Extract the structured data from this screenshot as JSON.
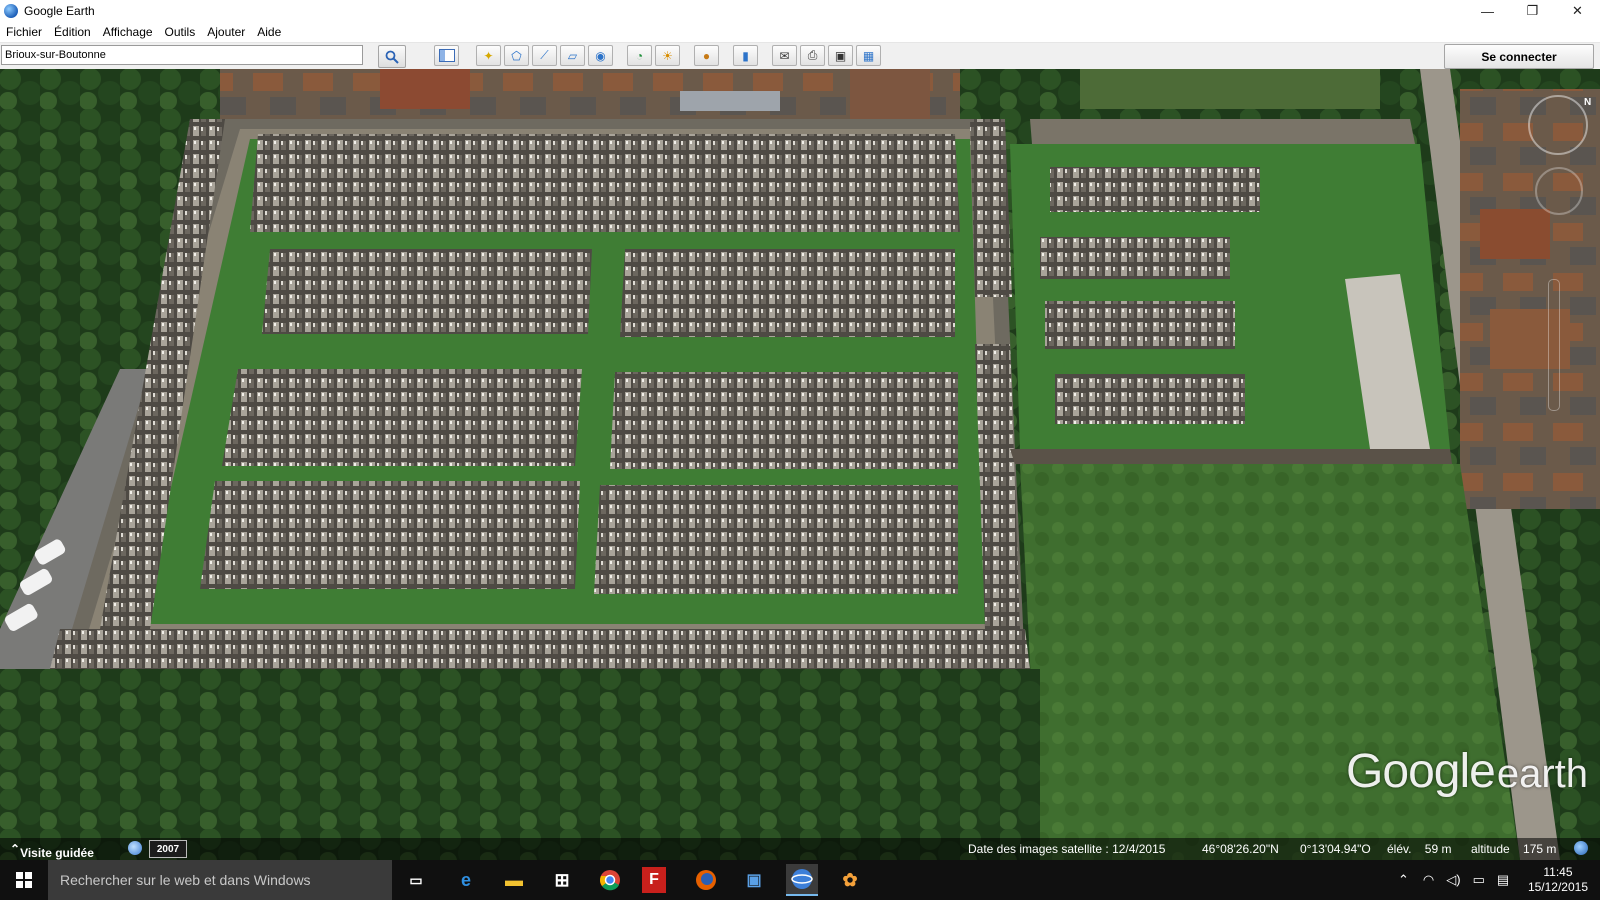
{
  "window": {
    "title": "Google Earth",
    "controls": [
      "—",
      "❐",
      "✕"
    ]
  },
  "menu": [
    "Fichier",
    "Édition",
    "Affichage",
    "Outils",
    "Ajouter",
    "Aide"
  ],
  "toolbar": {
    "search_value": "Brioux-sur-Boutonne",
    "connect_label": "Se connecter"
  },
  "map": {
    "logo_google": "Google",
    "logo_earth": "earth",
    "north_label": "N"
  },
  "status": {
    "tour_label": "Visite guidée",
    "year": "2007",
    "imagery_date": "Date des images satellite : 12/4/2015",
    "lat": "46°08'26.20\"N",
    "lon": "0°13'04.94\"O",
    "elev": "élév.    59 m",
    "altitude": "altitude    175 m"
  },
  "taskbar": {
    "search_placeholder": "Rechercher sur le web et dans Windows",
    "time": "11:45",
    "date": "15/12/2015"
  },
  "colors": {
    "grass": "#3f7d34",
    "path": "#8f8676",
    "accent_blue": "#76b9ed"
  }
}
